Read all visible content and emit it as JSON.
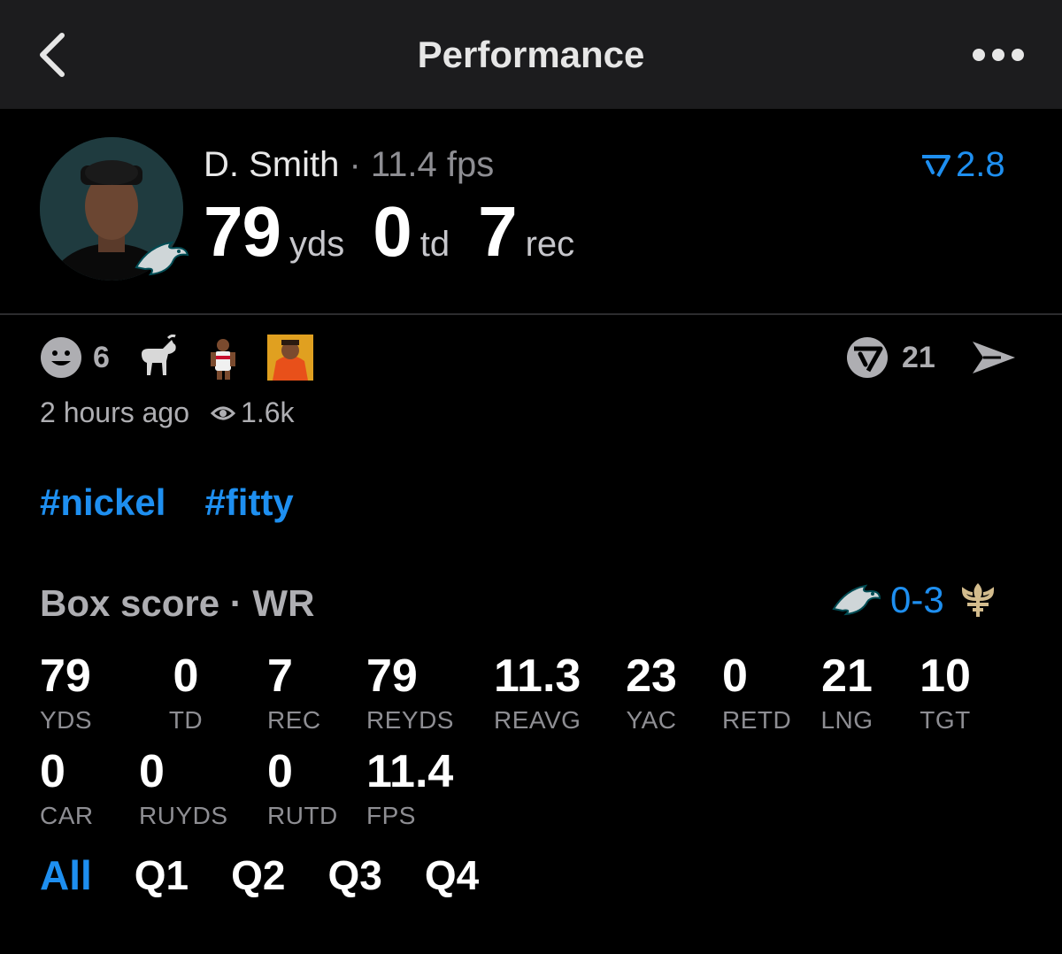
{
  "header": {
    "title": "Performance"
  },
  "player": {
    "name": "D. Smith",
    "separator": " · ",
    "fps": "11.4 fps",
    "yds_value": "79",
    "yds_unit": "yds",
    "td_value": "0",
    "td_unit": "td",
    "rec_value": "7",
    "rec_unit": "rec",
    "rank_value": "2.8"
  },
  "reactions": {
    "smiley_count": "6",
    "comments_count": "21"
  },
  "meta": {
    "time": "2 hours ago",
    "views": "1.6k"
  },
  "tags": [
    "#nickel",
    "#fitty"
  ],
  "box_score": {
    "title": "Box score",
    "separator": " · ",
    "position": "WR",
    "score": "0-3",
    "row1": [
      {
        "value": "79",
        "label": "YDS"
      },
      {
        "value": "0",
        "label": "TD"
      },
      {
        "value": "7",
        "label": "REC"
      },
      {
        "value": "79",
        "label": "REYDS"
      },
      {
        "value": "11.3",
        "label": "REAVG"
      },
      {
        "value": "23",
        "label": "YAC"
      },
      {
        "value": "0",
        "label": "RETD"
      },
      {
        "value": "21",
        "label": "LNG"
      },
      {
        "value": "10",
        "label": "TGT"
      }
    ],
    "row2": [
      {
        "value": "0",
        "label": "CAR"
      },
      {
        "value": "0",
        "label": "RUYDS"
      },
      {
        "value": "0",
        "label": "RUTD"
      },
      {
        "value": "11.4",
        "label": "FPS"
      }
    ]
  },
  "quarter_tabs": [
    "All",
    "Q1",
    "Q2",
    "Q3",
    "Q4"
  ],
  "colors": {
    "accent": "#1e8ff0",
    "nav_bg": "#1c1c1e",
    "muted": "#8e8e93"
  }
}
